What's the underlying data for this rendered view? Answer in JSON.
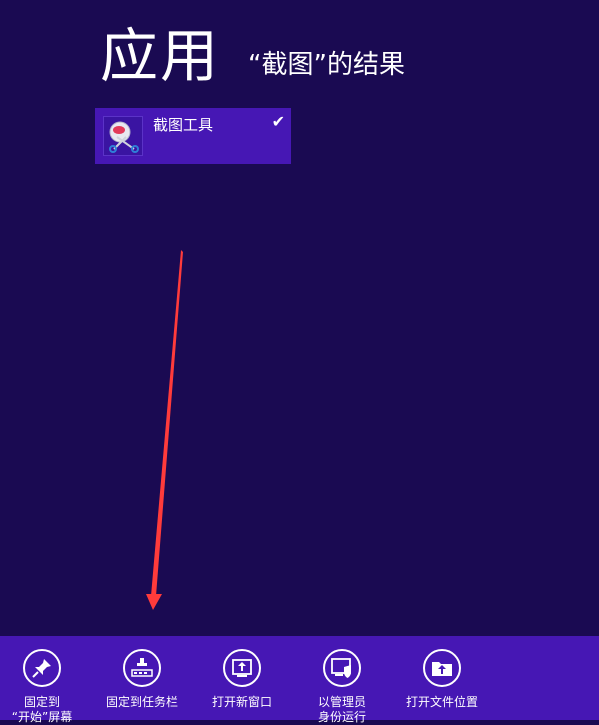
{
  "header": {
    "title": "应用",
    "subtitle": "“截图”的结果"
  },
  "result": {
    "app_name": "截图工具",
    "icon": "snipping-tool-icon",
    "selected": true
  },
  "annotation": {
    "color": "#ff3b3b"
  },
  "app_bar": {
    "buttons": [
      {
        "label": "固定到\n“开始”屏幕",
        "icon": "pin-icon"
      },
      {
        "label": "固定到任务栏",
        "icon": "taskbar-icon"
      },
      {
        "label": "打开新窗口",
        "icon": "new-window-icon"
      },
      {
        "label": "以管理员\n身份运行",
        "icon": "admin-shield-icon"
      },
      {
        "label": "打开文件位置",
        "icon": "open-folder-icon"
      }
    ]
  },
  "colors": {
    "background": "#1a0a52",
    "accent": "#4617b4"
  }
}
